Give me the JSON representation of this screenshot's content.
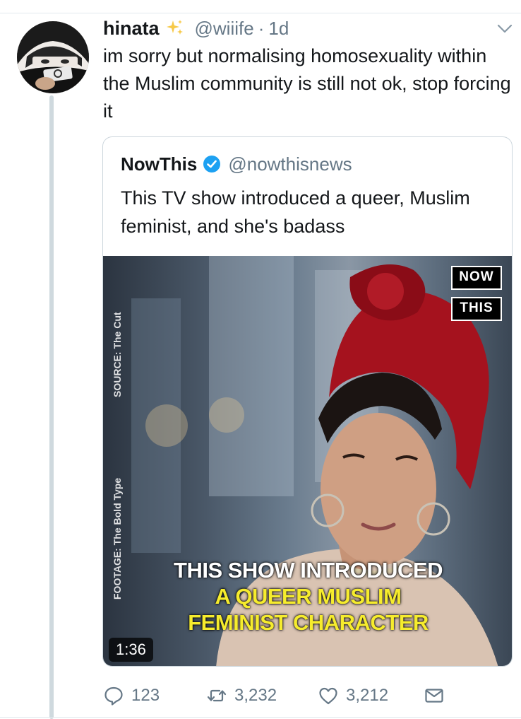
{
  "tweet": {
    "author_name": "hinata",
    "author_handle": "@wiiife",
    "separator": "·",
    "time": "1d",
    "text": "im sorry but normalising homosexuality within the Muslim community is still not ok, stop forcing it",
    "name_emoji": "sparkles-icon"
  },
  "quoted": {
    "author_name": "NowThis",
    "author_handle": "@nowthisnews",
    "verified": true,
    "text": "This TV show introduced a queer, Muslim feminist, and she's badass",
    "media": {
      "logo_line1": "NOW",
      "logo_line2": "THIS",
      "source_text": "SOURCE: The Cut",
      "footage_text": "FOOTAGE: The Bold Type",
      "caption_line1": "THIS SHOW INTRODUCED",
      "caption_line2": "A QUEER MUSLIM",
      "caption_line3": "FEMINIST CHARACTER",
      "duration": "1:36"
    }
  },
  "actions": {
    "replies": "123",
    "retweets": "3,232",
    "likes": "3,212"
  },
  "colors": {
    "text_primary": "#14171a",
    "text_secondary": "#657786",
    "verified_blue": "#1da1f2",
    "caption_yellow": "#f6ec2d",
    "border": "#ccd6dd"
  }
}
